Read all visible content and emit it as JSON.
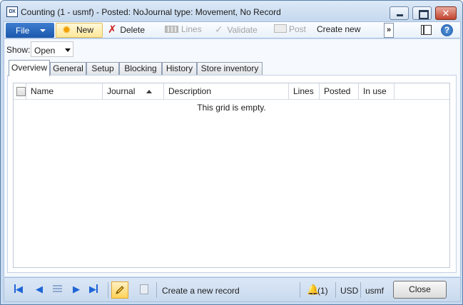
{
  "window": {
    "title": "Counting (1 - usmf) - Posted: NoJournal type: Movement, No Record",
    "app_icon_text": "DX",
    "controls": {
      "minimize_icon": "minimize-icon",
      "maximize_icon": "maximize-icon",
      "close_glyph": "✕"
    }
  },
  "action_pane": {
    "file_label": "File",
    "new_label": "New",
    "delete_label": "Delete",
    "lines_label": "Lines",
    "validate_label": "Validate",
    "post_label": "Post",
    "create_new_label": "Create new",
    "overflow_glyph": "»",
    "help_glyph": "?"
  },
  "filter": {
    "show_label": "Show:",
    "show_value": "Open"
  },
  "tabs": [
    {
      "label": "Overview",
      "active": true
    },
    {
      "label": "General",
      "active": false
    },
    {
      "label": "Setup",
      "active": false
    },
    {
      "label": "Blocking",
      "active": false
    },
    {
      "label": "History",
      "active": false
    },
    {
      "label": "Store inventory",
      "active": false
    }
  ],
  "grid": {
    "columns": [
      "Name",
      "Journal",
      "Description",
      "Lines",
      "Posted",
      "In use"
    ],
    "sorted_column": "Journal",
    "sort_direction": "ascending",
    "empty_message": "This grid is empty.",
    "rows": []
  },
  "status_bar": {
    "status_text": "Create a new record",
    "notification_count": "(1)",
    "currency": "USD",
    "company": "usmf",
    "close_label": "Close"
  },
  "colors": {
    "accent": "#1c58ad",
    "new_button": "#ffe79a",
    "delete_icon": "#cc2222",
    "nav_blue": "#1f65d6"
  }
}
